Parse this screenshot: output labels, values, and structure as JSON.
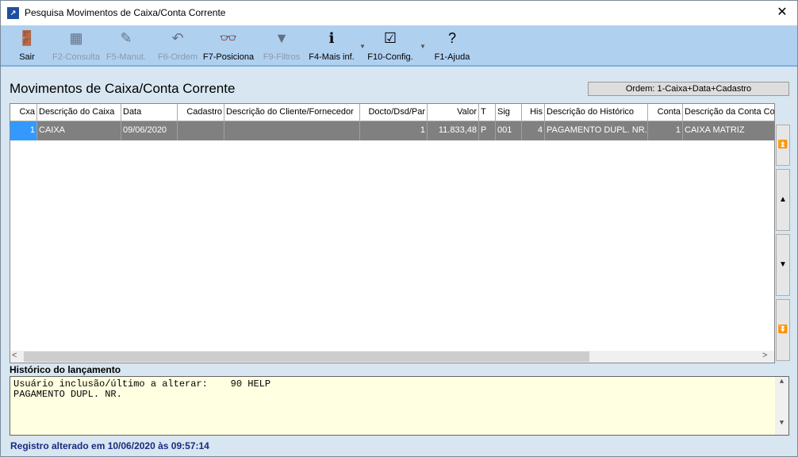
{
  "window": {
    "title": "Pesquisa Movimentos de Caixa/Conta Corrente",
    "close": "✕"
  },
  "toolbar": [
    {
      "label": "Sair",
      "icon": "exit-door-icon",
      "glyph": "🚪",
      "enabled": true
    },
    {
      "label": "F2-Consulta",
      "icon": "search-grid-icon",
      "glyph": "▦",
      "enabled": false
    },
    {
      "label": "F5-Manut.",
      "icon": "edit-pencil-icon",
      "glyph": "✎",
      "enabled": false
    },
    {
      "label": "F6-Ordem",
      "icon": "undo-arrow-icon",
      "glyph": "↶",
      "enabled": false
    },
    {
      "label": "F7-Posiciona",
      "icon": "binoculars-icon",
      "glyph": "👓",
      "enabled": true
    },
    {
      "label": "F9-Filtros",
      "icon": "funnel-icon",
      "glyph": "▼",
      "enabled": false
    },
    {
      "label": "F4-Mais inf.",
      "icon": "info-icon",
      "glyph": "ℹ",
      "enabled": true
    },
    {
      "label": "F10-Config.",
      "icon": "checklist-icon",
      "glyph": "☑",
      "enabled": true
    },
    {
      "label": "F1-Ajuda",
      "icon": "help-icon",
      "glyph": "?",
      "enabled": true
    }
  ],
  "heading": "Movimentos de Caixa/Conta Corrente",
  "order": "Ordem: 1-Caixa+Data+Cadastro",
  "grid": {
    "columns": [
      "Cxa",
      "Descrição do Caixa",
      "Data",
      "Cadastro",
      "Descrição do Cliente/Fornecedor",
      "Docto/Dsd/Par",
      "Valor",
      "T",
      "Sig",
      "His",
      "Descrição do Histórico",
      "Conta",
      "Descrição da Conta Co"
    ],
    "rows": [
      [
        "1",
        "CAIXA",
        "09/06/2020",
        "",
        "",
        "1",
        "11.833,48",
        "P",
        "001",
        "4",
        "PAGAMENTO DUPL. NR.",
        "1",
        "CAIXA MATRIZ"
      ]
    ]
  },
  "history": {
    "label": "Histórico do lançamento",
    "text": "Usuário inclusão/último a alterar:    90 HELP\nPAGAMENTO DUPL. NR."
  },
  "status": "Registro alterado em 10/06/2020 às 09:57:14"
}
